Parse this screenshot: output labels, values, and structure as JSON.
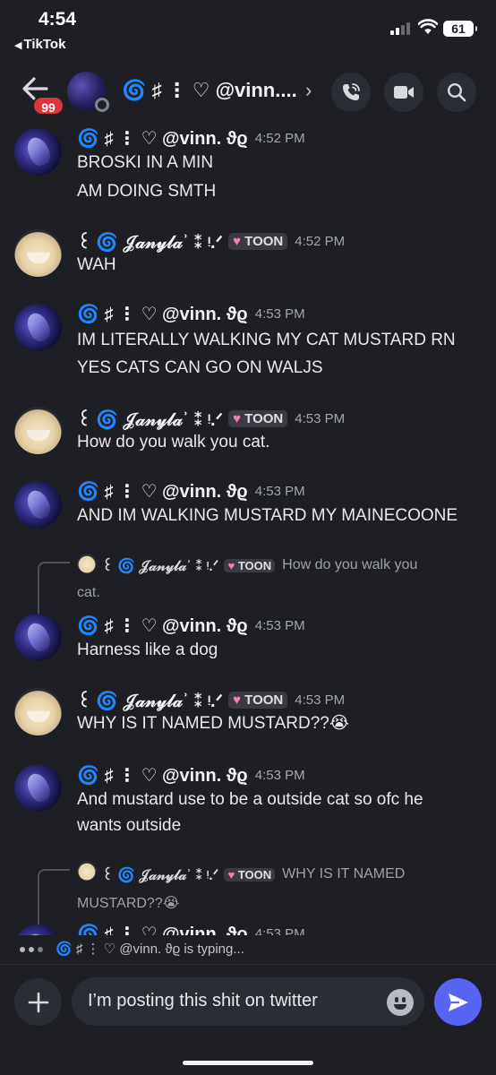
{
  "status_bar": {
    "time": "4:54",
    "back_app": "TikTok",
    "battery": "61"
  },
  "header": {
    "back_icon": "arrow-left-icon",
    "unread_badge": "99",
    "title": "🌀 ♯ ⋮ ♡ @vinn....",
    "chevron": "›",
    "call_icon": "phone-call-icon",
    "video_icon": "video-camera-icon",
    "search_icon": "search-icon"
  },
  "messages": [
    {
      "type": "message",
      "author": "🌀 ♯ ⋮ ♡ @vinn. ϑϱ",
      "time": "4:52 PM",
      "lines": [
        "BROSKI IN A MIN",
        "AM DOING SMTH"
      ]
    },
    {
      "type": "message",
      "author": "꒰ 🌀 𝒥𝒶𝓃𝓎𝓁𝒶ʾ ⁑ ᵎ.ᐟ",
      "tag": "TOON",
      "time": "4:52 PM",
      "lines": [
        "WAH"
      ]
    },
    {
      "type": "message",
      "author": "🌀 ♯ ⋮ ♡ @vinn. ϑϱ",
      "time": "4:53 PM",
      "lines": [
        "IM LITERALLY WALKING MY CAT MUSTARD RN",
        "YES CATS CAN GO ON WALJS"
      ]
    },
    {
      "type": "message",
      "author": "꒰ 🌀 𝒥𝒶𝓃𝓎𝓁𝒶ʾ ⁑ ᵎ.ᐟ",
      "tag": "TOON",
      "time": "4:53 PM",
      "lines": [
        "How do you walk you cat."
      ]
    },
    {
      "type": "message",
      "author": "🌀 ♯ ⋮ ♡ @vinn. ϑϱ",
      "time": "4:53 PM",
      "lines": [
        "AND IM WALKING MUSTARD MY MAINECOONE"
      ]
    },
    {
      "type": "message",
      "author": "🌀 ♯ ⋮ ♡ @vinn. ϑϱ",
      "time": "4:53 PM",
      "lines": [
        "Harness like a dog"
      ],
      "reply": {
        "author": "꒰ 🌀 𝒥𝒶𝓃𝓎𝓁𝒶ʾ ⁑ ᵎ.ᐟ",
        "tag": "TOON",
        "text": "How do you walk you",
        "text_cont": "cat."
      }
    },
    {
      "type": "message",
      "author": "꒰ 🌀 𝒥𝒶𝓃𝓎𝓁𝒶ʾ ⁑ ᵎ.ᐟ",
      "tag": "TOON",
      "time": "4:53 PM",
      "lines": [
        "WHY IS IT NAMED MUSTARD??😭"
      ]
    },
    {
      "type": "message",
      "author": "🌀 ♯ ⋮ ♡ @vinn. ϑϱ",
      "time": "4:53 PM",
      "lines": [
        "And mustard use to be a outside cat so ofc he",
        "wants outside"
      ]
    },
    {
      "type": "message",
      "author": "🌀 ♯ ⋮ ♡ @vinn. ϑϱ",
      "time": "4:53 PM",
      "lines": [],
      "reply": {
        "author": "꒰ 🌀 𝒥𝒶𝓃𝓎𝓁𝒶ʾ ⁑ ᵎ.ᐟ",
        "tag": "TOON",
        "text": "WHY IS IT NAMED",
        "text_cont": "MUSTARD??😭"
      }
    }
  ],
  "typing": {
    "text": "🌀 ♯ ⋮ ♡ @vinn. ϑϱ is typing..."
  },
  "composer": {
    "value": "I’m posting this shit on twitter",
    "plus_icon": "plus-icon",
    "emoji_icon": "emoji-icon",
    "send_icon": "send-icon"
  },
  "colors": {
    "background": "#1e1f25",
    "accent": "#5865f2",
    "badge": "#e0343c"
  }
}
